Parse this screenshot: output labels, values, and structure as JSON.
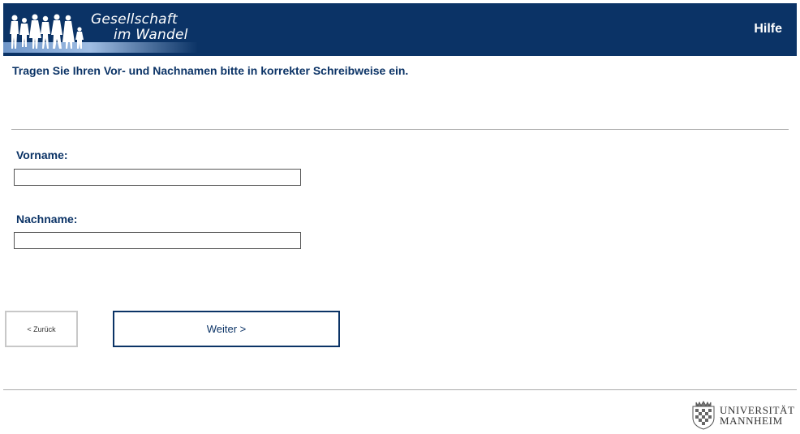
{
  "header": {
    "logo_line1": "Gesellschaft",
    "logo_line2": "im Wandel",
    "help_label": "Hilfe",
    "background_color": "#0b3366"
  },
  "instruction": "Tragen Sie Ihren Vor- und Nachnamen bitte in korrekter Schreibweise ein.",
  "form": {
    "first_name_label": "Vorname:",
    "first_name_value": "",
    "last_name_label": "Nachname:",
    "last_name_value": ""
  },
  "navigation": {
    "back_label": "< Zurück",
    "next_label": "Weiter >"
  },
  "footer": {
    "university_line1": "UNIVERSITÄT",
    "university_line2": "MANNHEIM",
    "crest_icon": "university-crest-icon"
  }
}
